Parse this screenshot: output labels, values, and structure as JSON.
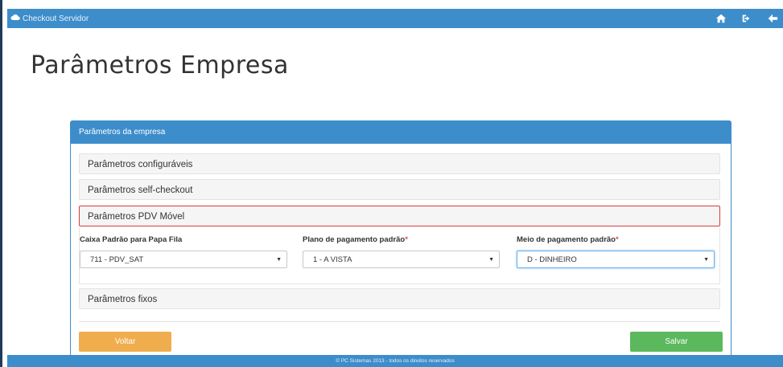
{
  "navbar": {
    "brand": "Checkout Servidor",
    "icons": [
      "home-icon",
      "sign-out-icon",
      "arrow-left-icon"
    ]
  },
  "page": {
    "title": "Parâmetros Empresa"
  },
  "panel": {
    "heading": "Parâmetros da empresa",
    "sections": [
      "Parâmetros configuráveis",
      "Parâmetros self-checkout",
      "Parâmetros PDV Móvel",
      "Parâmetros fixos"
    ],
    "fields": {
      "caixa": {
        "label": "Caixa Padrão para Papa Fila",
        "value": "711 - PDV_SAT"
      },
      "plano": {
        "label": "Plano de pagamento padrão",
        "required": "*",
        "value": "1 - A VISTA"
      },
      "meio": {
        "label": "Meio de pagamento padrão",
        "required": "*",
        "value": "D - DINHEIRO"
      }
    },
    "buttons": {
      "back": "Voltar",
      "save": "Salvar"
    }
  },
  "footer": {
    "text": "© PC Sistemas 2013 - todos os direitos reservados"
  },
  "colors": {
    "primary": "#3d8dcb",
    "warning": "#f0ad4e",
    "success": "#5cb85c",
    "highlight": "#e03a3a"
  }
}
